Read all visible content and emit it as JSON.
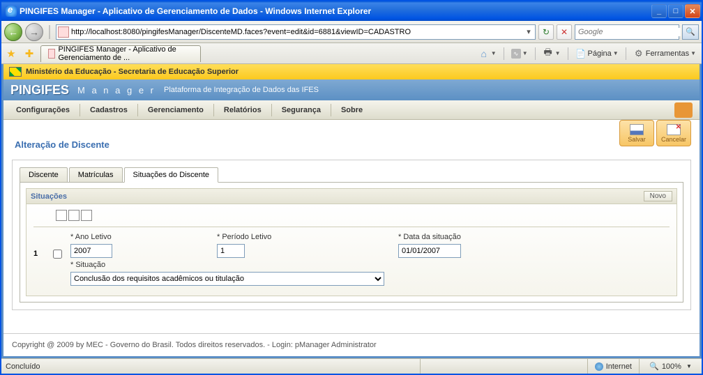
{
  "window": {
    "title": "PINGIFES Manager - Aplicativo de Gerenciamento de Dados - Windows Internet Explorer"
  },
  "browser": {
    "url": "http://localhost:8080/pingifesManager/DiscenteMD.faces?event=edit&id=6881&viewID=CADASTRO",
    "search_placeholder": "Google",
    "tab_title": "PINGIFES Manager - Aplicativo de Gerenciamento de ...",
    "menu": {
      "pagina": "Página",
      "ferramentas": "Ferramentas"
    }
  },
  "gov_header": "Ministério da Educação - Secretaria de Educação Superior",
  "brand": {
    "name": "PINGIFES",
    "sub": "M a n a g e r",
    "tag": "Plataforma de Integração de Dados das IFES"
  },
  "menu": [
    "Configurações",
    "Cadastros",
    "Gerenciamento",
    "Relatórios",
    "Segurança",
    "Sobre"
  ],
  "actions": {
    "salvar": "Salvar",
    "cancelar": "Cancelar"
  },
  "page": {
    "title": "Alteração de Discente"
  },
  "tabs": {
    "t1": "Discente",
    "t2": "Matrículas",
    "t3": "Situações do Discente"
  },
  "panel": {
    "title": "Situações",
    "novo": "Novo"
  },
  "form": {
    "row_num": "1",
    "ano_letivo_label": "* Ano Letivo",
    "ano_letivo": "2007",
    "periodo_letivo_label": "* Período Letivo",
    "periodo_letivo": "1",
    "data_situacao_label": "* Data da situação",
    "data_situacao": "01/01/2007",
    "situacao_label": "* Situação",
    "situacao": "Conclusão dos requisitos acadêmicos ou titulação"
  },
  "footer": "Copyright @ 2009 by MEC - Governo do Brasil. Todos direitos reservados. - Login: pManager Administrator",
  "status": {
    "left": "Concluído",
    "zone": "Internet",
    "zoom": "100%"
  }
}
